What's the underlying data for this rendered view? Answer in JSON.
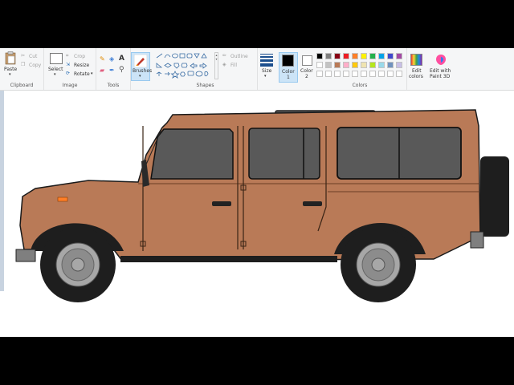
{
  "ribbon": {
    "clipboard": {
      "paste": "Paste",
      "cut": "Cut",
      "copy": "Copy",
      "label": "Clipboard"
    },
    "image": {
      "select": "Select",
      "crop": "Crop",
      "resize": "Resize",
      "rotate": "Rotate",
      "label": "Image"
    },
    "tools": {
      "label": "Tools",
      "text_tool": "A"
    },
    "brushes": {
      "label": "Brushes"
    },
    "shapes": {
      "outline": "Outline",
      "fill": "Fill",
      "label": "Shapes"
    },
    "size": {
      "label": "Size"
    },
    "color1": {
      "label": "Color",
      "num": "1"
    },
    "color2": {
      "label": "Color",
      "num": "2"
    },
    "colors": {
      "label": "Colors"
    },
    "edit_colors": {
      "line1": "Edit",
      "line2": "colors"
    },
    "paint3d": {
      "line1": "Edit with",
      "line2": "Paint 3D"
    }
  },
  "palette": {
    "row1": [
      "#000000",
      "#7f7f7f",
      "#880015",
      "#ed1c24",
      "#ff7f27",
      "#fff200",
      "#22b14c",
      "#00a2e8",
      "#3f48cc",
      "#a349a4"
    ],
    "row2": [
      "#ffffff",
      "#c3c3c3",
      "#b97a57",
      "#ffaec9",
      "#ffc90e",
      "#efe4b0",
      "#b5e61d",
      "#99d9ea",
      "#7092be",
      "#c8bfe7"
    ],
    "row3": [
      "#ffffff",
      "#ffffff",
      "#ffffff",
      "#ffffff",
      "#ffffff",
      "#ffffff",
      "#ffffff",
      "#ffffff",
      "#ffffff",
      "#ffffff"
    ]
  },
  "colors": {
    "body": "#b97a57",
    "window": "#595959",
    "tire": "#1e1e1e",
    "rim": "#a7a7a7",
    "bumper": "#7f7f7f",
    "indicator": "#ff7f27"
  }
}
